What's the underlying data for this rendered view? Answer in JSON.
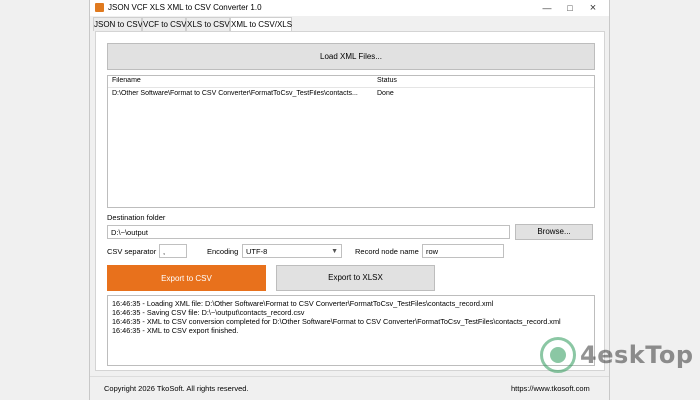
{
  "window": {
    "title": "JSON VCF XLS XML to CSV Converter 1.0",
    "minimize_icon": "minimize-icon",
    "maximize_icon": "maximize-icon",
    "close_icon": "close-icon"
  },
  "tabs": [
    {
      "label": "JSON to CSV",
      "active": false
    },
    {
      "label": "VCF to CSV",
      "active": false
    },
    {
      "label": "XLS to CSV",
      "active": false
    },
    {
      "label": "XML to CSV/XLS",
      "active": true
    }
  ],
  "load_button": {
    "label": "Load XML Files..."
  },
  "file_grid": {
    "columns": [
      "Filename",
      "Status"
    ],
    "rows": [
      {
        "filename": "D:\\Other Software\\Format to CSV Converter\\FormatToCsv_TestFiles\\contacts...",
        "status": "Done"
      }
    ]
  },
  "destination": {
    "label": "Destination folder",
    "value": "D:\\~\\output",
    "browse_label": "Browse..."
  },
  "options": {
    "separator_label": "CSV separator",
    "separator_value": ",",
    "encoding_label": "Encoding",
    "encoding_value": "UTF-8",
    "record_label": "Record node name",
    "record_value": "row"
  },
  "actions": {
    "export_csv_label": "Export to CSV",
    "export_xlsx_label": "Export to XLSX"
  },
  "log": [
    "16:46:35 - Loading XML file: D:\\Other Software\\Format to CSV Converter\\FormatToCsv_TestFiles\\contacts_record.xml",
    "16:46:35 - Saving CSV file: D:\\~\\output\\contacts_record.csv",
    "16:46:35 - XML to CSV conversion completed for D:\\Other Software\\Format to CSV Converter\\FormatToCsv_TestFiles\\contacts_record.xml",
    "16:46:35 - XML to CSV export finished."
  ],
  "footer": {
    "copyright": "Copyright 2026 TkoSoft. All rights reserved.",
    "url": "https://www.tkosoft.com"
  },
  "watermark": {
    "text": "4eskTop"
  },
  "colors": {
    "accent_orange": "#e8711c",
    "button_gray": "#e1e1e1"
  }
}
